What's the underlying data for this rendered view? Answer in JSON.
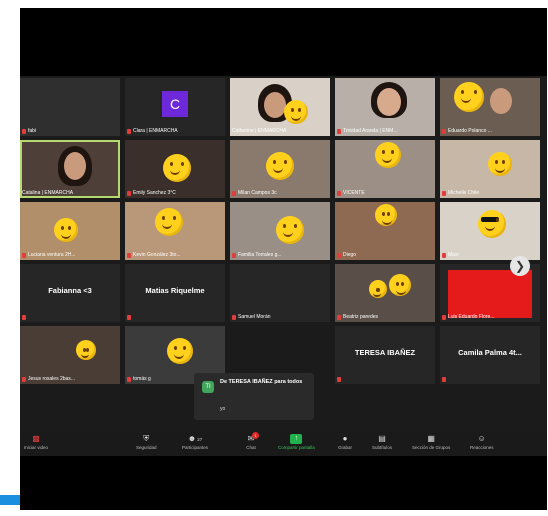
{
  "participants": [
    {
      "name": "fabi",
      "mic_muted": true
    },
    {
      "name": "Clara | ENMARCHA",
      "avatar_letter": "C",
      "mic_muted": true
    },
    {
      "name": "Catherine | ENMARCHA",
      "mic_muted": false
    },
    {
      "name": "Trinidad Aranda | ENM...",
      "mic_muted": true
    },
    {
      "name": "Eduardo Polanco ...",
      "mic_muted": true
    },
    {
      "name": "Catalina | ENMARCHA",
      "mic_muted": false
    },
    {
      "name": "Emily Sanchez 3°C",
      "mic_muted": true
    },
    {
      "name": "Milan Campos 3c",
      "mic_muted": true
    },
    {
      "name": "VICENTE",
      "mic_muted": true
    },
    {
      "name": "Michelle Chile",
      "mic_muted": true
    },
    {
      "name": "Luciana ventura 2H...",
      "mic_muted": true
    },
    {
      "name": "Kevin González 3to...",
      "mic_muted": true
    },
    {
      "name": "Familia Torrales g...",
      "mic_muted": true
    },
    {
      "name": "Diego",
      "mic_muted": true
    },
    {
      "name": "Maxi",
      "mic_muted": true
    },
    {
      "name": "Fabianna <3",
      "mic_muted": true
    },
    {
      "name": "Matias Riquelme",
      "mic_muted": true
    },
    {
      "name": "Samuel Morán",
      "mic_muted": true
    },
    {
      "name": "Beatriz paredes",
      "mic_muted": true
    },
    {
      "name": "Luis Eduardo Flore...",
      "mic_muted": true
    },
    {
      "name": "Jesus rosales 2bas...",
      "mic_muted": true
    },
    {
      "name": "tomás g",
      "mic_muted": true
    },
    {
      "name": "TERESA IBAÑEZ",
      "mic_muted": true
    },
    {
      "name": "Camila Palma 4t...",
      "mic_muted": true
    }
  ],
  "chat_popup": {
    "avatar_initials": "TI",
    "from_line": "De TERESA IBAÑEZ para todos",
    "message": "yo"
  },
  "toolbar": {
    "start_video": "Iniciar video",
    "security": "Seguridad",
    "participants": "Participantes",
    "participants_count": "27",
    "chat": "Chat",
    "chat_badge": "1",
    "share_screen": "Compartir pantalla",
    "record": "Grabar",
    "subtitles": "Subtítulos",
    "breakout": "Sección de Grupos",
    "reactions": "Reacciones"
  },
  "colors": {
    "share_green": "#21b14d",
    "active_speaker": "#b5d96f",
    "avatar_purple": "#6d28d9",
    "muted_red": "#e23d3d"
  }
}
